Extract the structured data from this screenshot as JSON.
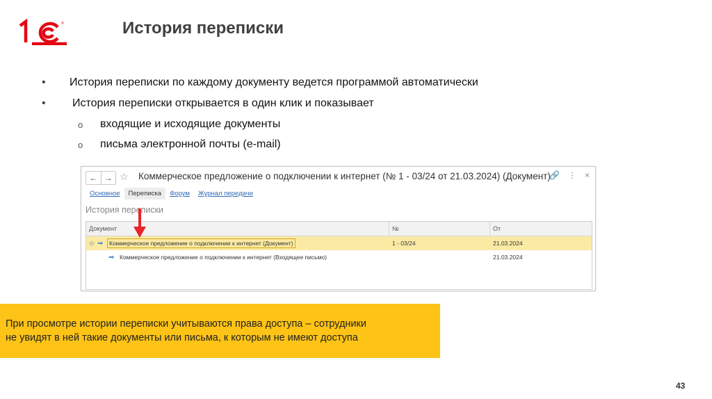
{
  "slide": {
    "title": "История переписки",
    "page_number": "43",
    "brand_color": "#e30613",
    "accent_color": "#fdc316"
  },
  "bullets": [
    "История переписки по каждому документу ведется программой автоматически",
    "История переписки открывается в один клик и показывает"
  ],
  "bullet_mark": "•",
  "sub_bullet_mark": "o",
  "sub_bullets": [
    "входящие и исходящие документы",
    "письма электронной почты (e-mail)"
  ],
  "window": {
    "back_label": "←",
    "forward_label": "→",
    "star_label": "☆",
    "title": "Коммерческое предложение о подключении к интернет (№ 1 - 03/24 от 21.03.2024) (Документ)",
    "link_icon": "🔗",
    "menu_icon": "⋮",
    "close_icon": "×",
    "tabs": [
      "Основное",
      "Переписка",
      "Форум",
      "Журнал передачи"
    ],
    "panel_title": "История переписки",
    "columns": [
      "Документ",
      "№",
      "От"
    ],
    "rows": [
      {
        "toggle": "⊖",
        "icon": "➡",
        "document": "Коммерческое предложение о подключении к интернет (Документ)",
        "number": "1 - 03/24",
        "date": "21.03.2024"
      },
      {
        "toggle": "",
        "icon": "➡",
        "document": "Коммерческое предложение о подключении к интернет (Входящее письмо)",
        "number": "",
        "date": "21.03.2024"
      }
    ]
  },
  "note": {
    "text_line1": "При просмотре истории переписки учитываются права доступа – сотрудники",
    "text_line2": "не увидят в ней такие документы или письма, к которым не имеют доступа"
  }
}
